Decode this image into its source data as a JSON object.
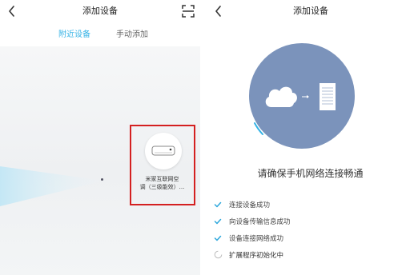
{
  "left_screen": {
    "title": "添加设备",
    "tabs": [
      {
        "label": "附近设备",
        "active": true
      },
      {
        "label": "手动添加",
        "active": false
      }
    ],
    "device": {
      "name_line1": "米家互联网空",
      "name_line2": "调（三级能效）..."
    },
    "icons": {
      "back": "chevron-left-icon",
      "scan": "scan-icon",
      "device": "air-conditioner-icon"
    }
  },
  "right_screen": {
    "title": "添加设备",
    "status_title": "请确保手机网络连接畅通",
    "steps": [
      {
        "label": "连接设备成功",
        "state": "done"
      },
      {
        "label": "向设备传输信息成功",
        "state": "done"
      },
      {
        "label": "设备连接网络成功",
        "state": "done"
      },
      {
        "label": "扩展程序初始化中",
        "state": "loading"
      }
    ],
    "icons": {
      "back": "chevron-left-icon",
      "cloud": "cloud-icon",
      "arrow": "arrow-right-icon",
      "device": "device-panel-icon",
      "check": "check-icon",
      "loading": "loading-spinner-icon"
    }
  },
  "colors": {
    "accent": "#36b3e6",
    "highlight": "#d42020",
    "circle": "#7b93bb",
    "check": "#2ea8dc"
  }
}
